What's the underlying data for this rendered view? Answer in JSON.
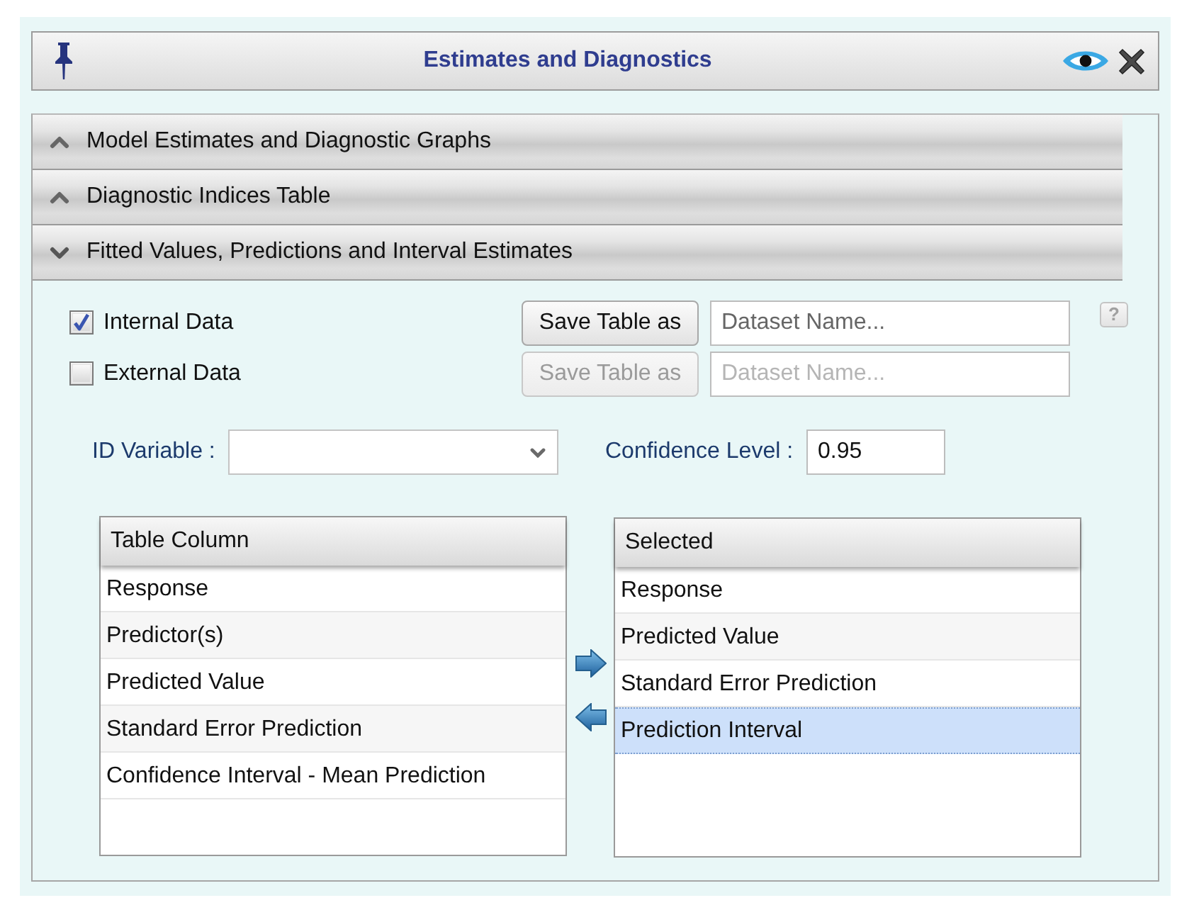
{
  "window": {
    "title": "Estimates and Diagnostics"
  },
  "sections": [
    {
      "title": "Model Estimates and Diagnostic Graphs",
      "expanded": false
    },
    {
      "title": "Diagnostic Indices Table",
      "expanded": false
    },
    {
      "title": "Fitted Values, Predictions and Interval Estimates",
      "expanded": true
    }
  ],
  "data_sources": [
    {
      "label": "Internal Data",
      "checked": true,
      "save_button": "Save Table as",
      "dataset_placeholder": "Dataset Name...",
      "disabled": false
    },
    {
      "label": "External Data",
      "checked": false,
      "save_button": "Save Table as",
      "dataset_placeholder": "Dataset Name...",
      "disabled": true
    }
  ],
  "help_button": {
    "label": "?"
  },
  "id_variable": {
    "label": "ID Variable :"
  },
  "confidence_level": {
    "label": "Confidence Level :",
    "value": "0.95"
  },
  "available_list": {
    "header": "Table Column",
    "items": [
      {
        "label": "Response",
        "selected": false
      },
      {
        "label": "Predictor(s)",
        "selected": false
      },
      {
        "label": "Predicted Value",
        "selected": false
      },
      {
        "label": "Standard Error Prediction",
        "selected": false
      },
      {
        "label": "Confidence Interval - Mean Prediction",
        "selected": false
      }
    ]
  },
  "selected_list": {
    "header": "Selected",
    "items": [
      {
        "label": "Response",
        "selected": false
      },
      {
        "label": "Predicted Value",
        "selected": false
      },
      {
        "label": "Standard Error Prediction",
        "selected": false
      },
      {
        "label": "Prediction Interval",
        "selected": true
      }
    ]
  }
}
